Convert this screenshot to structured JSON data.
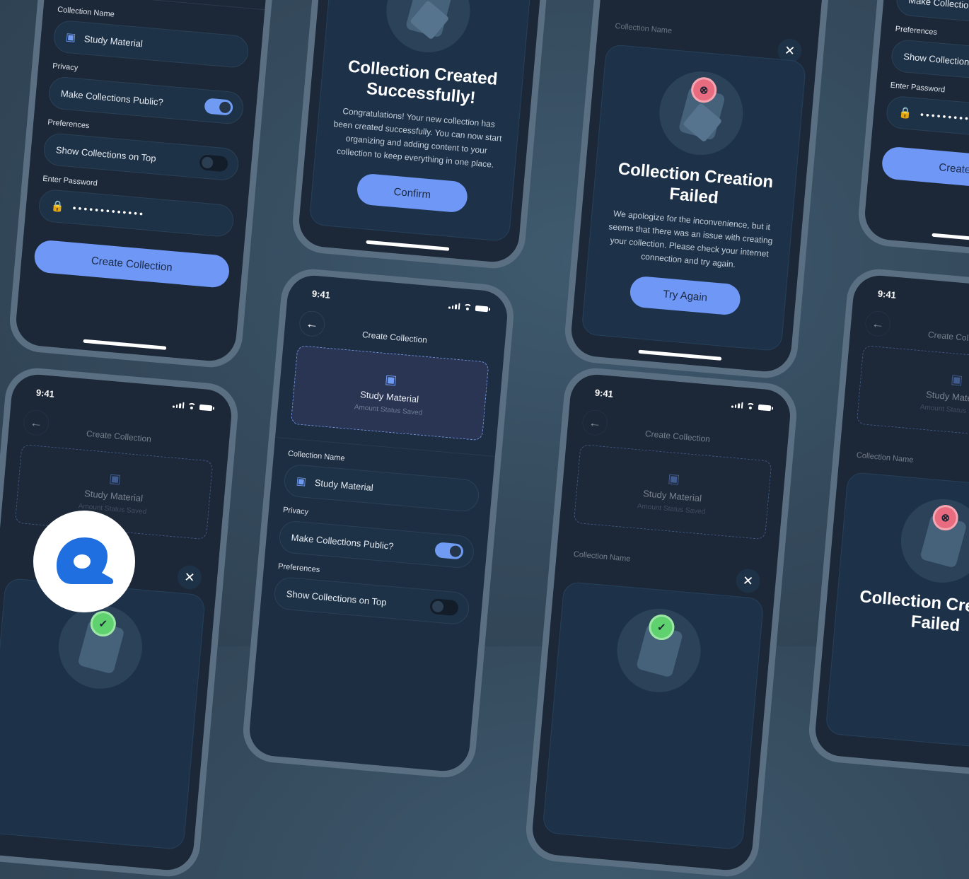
{
  "status_bar": {
    "time": "9:41"
  },
  "header": {
    "title": "Create Collection"
  },
  "preview_card": {
    "title": "Study Material",
    "subtitle": "Amount Status Saved"
  },
  "form": {
    "collection_name_label": "Collection Name",
    "collection_name_value": "Study Material",
    "privacy_label": "Privacy",
    "privacy_toggle_label": "Make Collections Public?",
    "privacy_toggle_on": true,
    "preferences_label": "Preferences",
    "preferences_toggle_label": "Show Collections on Top",
    "preferences_toggle_on": false,
    "password_label": "Enter Password",
    "password_value": "•••••••••••••",
    "submit_label": "Create Collection"
  },
  "success_modal": {
    "title": "Collection Created Successfully!",
    "body": "Congratulations! Your new collection has been created successfully. You can now start organizing and adding content to your collection to keep everything in one place.",
    "button_label": "Confirm"
  },
  "error_modal": {
    "title": "Collection Creation Failed",
    "body": "We apologize for the inconvenience, but it seems that there was an issue with creating your collection. Please check your internet connection and try again.",
    "button_label": "Try Again"
  },
  "icons": {
    "back": "←",
    "close": "✕",
    "book": "▣",
    "lock": "🔒",
    "check": "✓",
    "error": "⊗"
  },
  "colors": {
    "accent": "#6f97f5",
    "success": "#5fd16e",
    "error": "#e96b80",
    "background": "#34495b",
    "screen": "#1c2737"
  }
}
